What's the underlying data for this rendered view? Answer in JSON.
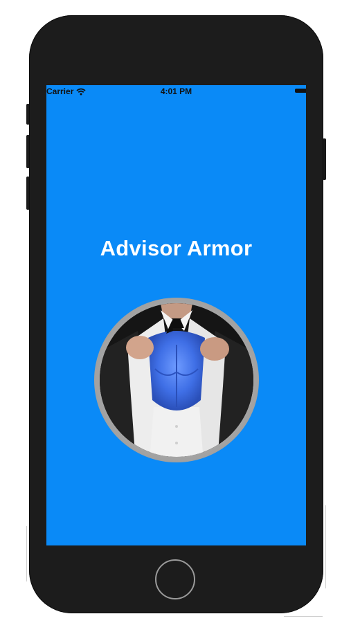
{
  "status_bar": {
    "carrier": "Carrier",
    "time": "4:01 PM",
    "wifi_icon": "wifi-icon",
    "battery_icon": "battery-icon"
  },
  "screen": {
    "background_color": "#0a8af7",
    "title": "Advisor Armor",
    "title_color": "#ffffff",
    "hero_image": "businessman-opening-shirt-revealing-blue-superhero-chest"
  },
  "device": {
    "body_color": "#1c1c1c",
    "home_button_icon": "home-button"
  }
}
